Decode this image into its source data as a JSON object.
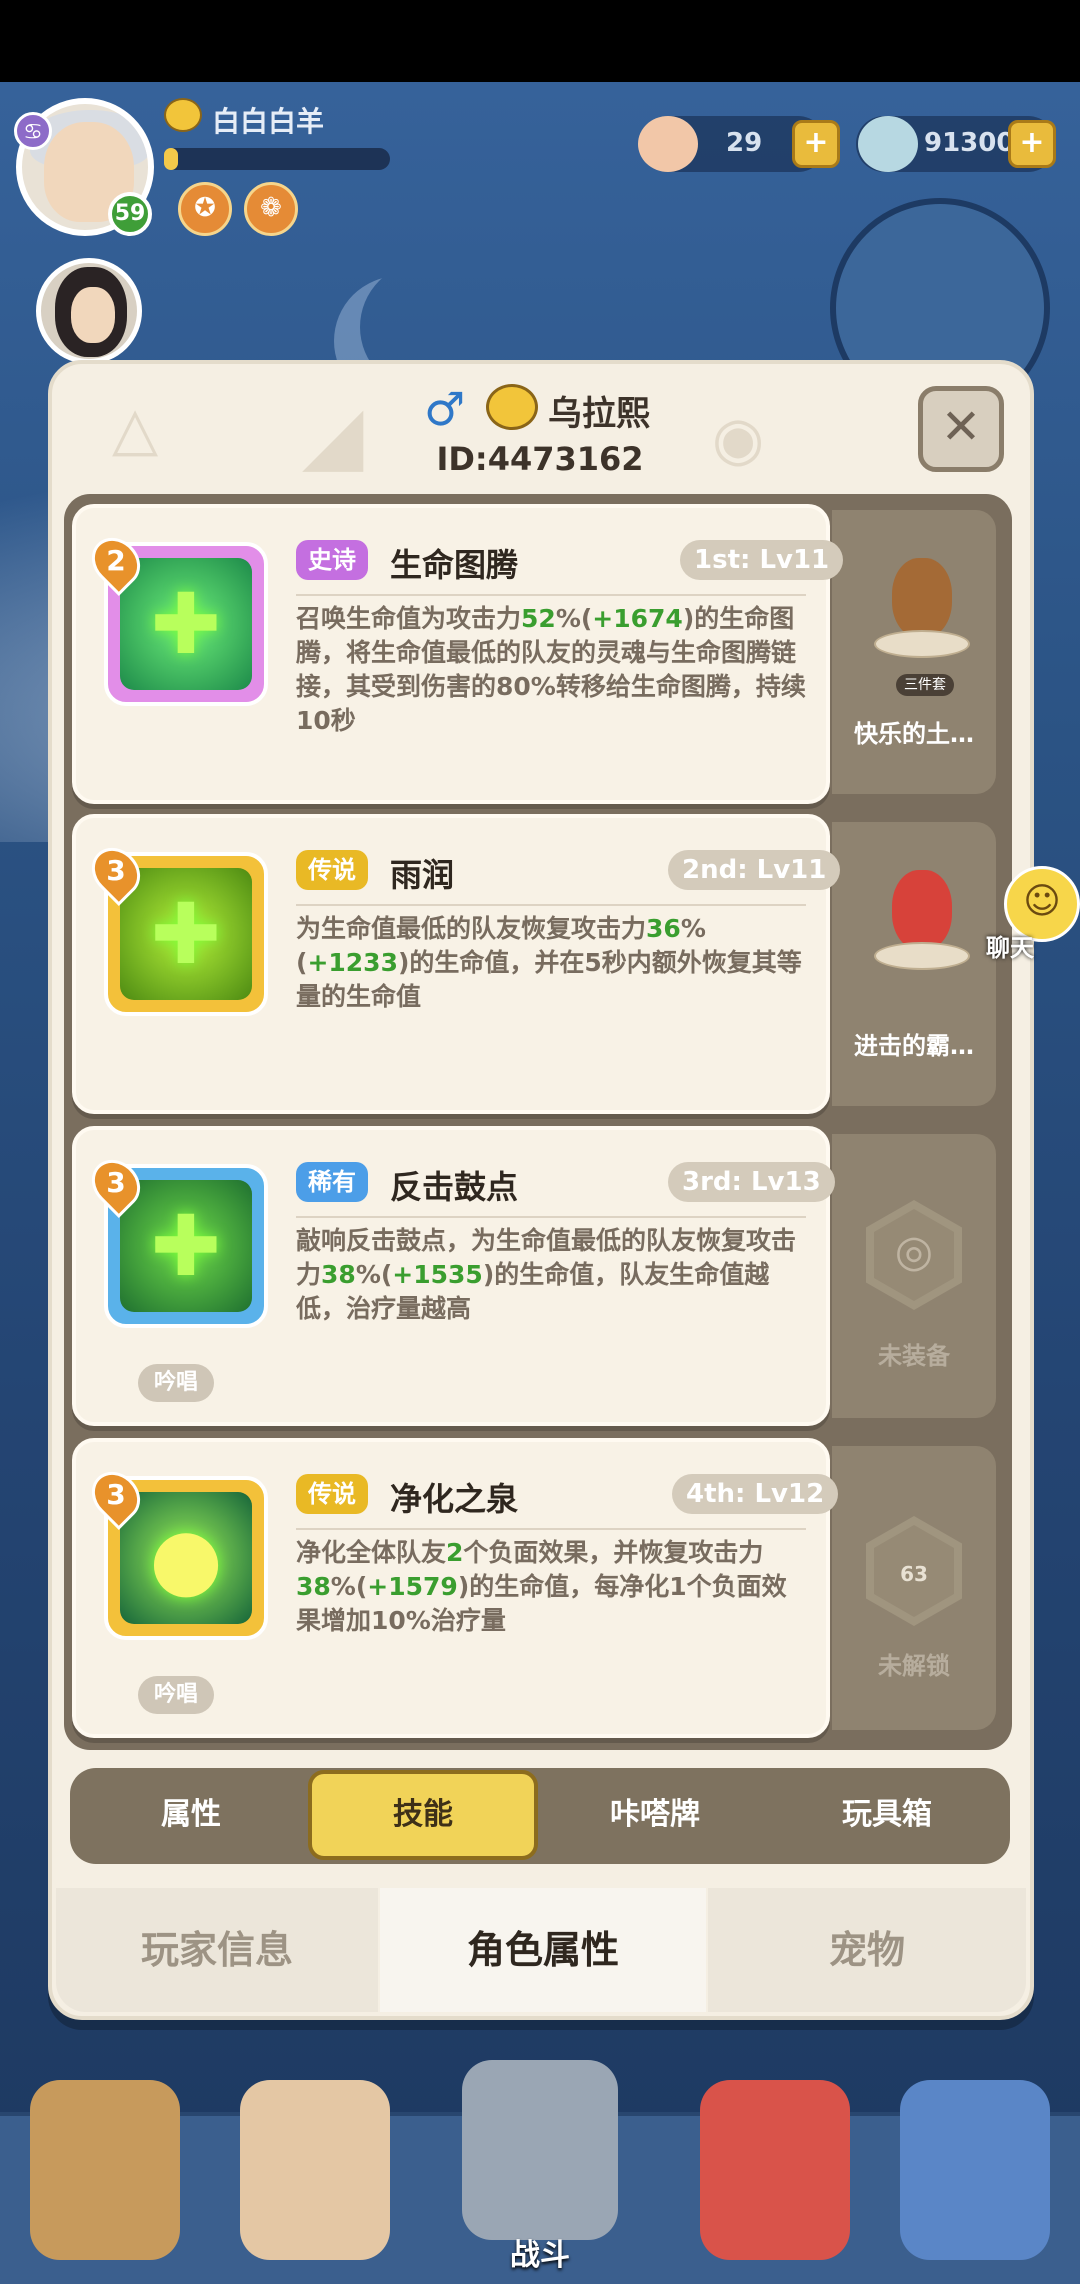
{
  "player": {
    "name": "白白白羊",
    "level": "59",
    "sign_glyph": "♋",
    "exp_fraction": 0.06
  },
  "resources": [
    {
      "icon": "shell-icon",
      "value": "29"
    },
    {
      "icon": "pearl-icon",
      "value": "91300"
    }
  ],
  "modal": {
    "gender_glyph": "♂",
    "name": "乌拉熙",
    "id": "ID:4473162",
    "close_glyph": "✕"
  },
  "skills": [
    {
      "level": "2",
      "rarity": "史诗",
      "rarity_color": "#c46fe0",
      "title": "生命图腾",
      "slot": "1st: Lv11",
      "desc_parts": [
        "召唤生命值为攻击力",
        "52",
        "%(",
        "+1674",
        ")的生命图腾，将生命值最低的队友的灵魂与生命图腾链接，其受到伤害的80%转移给生命图腾，持续10秒"
      ],
      "icon": "totem-icon"
    },
    {
      "level": "3",
      "rarity": "传说",
      "rarity_color": "#e9b925",
      "title": "雨润",
      "slot": "2nd: Lv11",
      "desc_parts": [
        "为生命值最低的队友恢复攻击力",
        "36",
        "%(",
        "+1233",
        ")的生命值，并在5秒内额外恢复其等量的生命值"
      ],
      "icon": "rain-heal-icon"
    },
    {
      "level": "3",
      "rarity": "稀有",
      "rarity_color": "#4c9ee8",
      "title": "反击鼓点",
      "slot": "3rd: Lv13",
      "desc_parts": [
        "敲响反击鼓点，为生命值最低的队友恢复攻击力",
        "38",
        "%(",
        "+1535",
        ")的生命值，队友生命值越低，治疗量越高"
      ],
      "tag": "吟唱",
      "icon": "drum-icon"
    },
    {
      "level": "3",
      "rarity": "传说",
      "rarity_color": "#e9b925",
      "title": "净化之泉",
      "slot": "4th: Lv12",
      "desc_parts": [
        "净化全体队友",
        "2",
        "个负面效果，并恢复攻击力",
        "38",
        "%(",
        "+1579",
        ")的生命值，每净化1个负面效果增加10%治疗量"
      ],
      "tag": "吟唱",
      "icon": "spring-icon"
    }
  ],
  "equipment": [
    {
      "label": "快乐的土…",
      "set_label": "三件套",
      "icon": "monkey-figure-icon"
    },
    {
      "label": "进击的霸…",
      "icon": "dino-figure-icon"
    },
    {
      "label": "未装备",
      "icon": "empty-hex-icon"
    },
    {
      "label": "未解锁",
      "lock_level": "63",
      "icon": "lock-icon"
    }
  ],
  "chat": {
    "label": "聊天"
  },
  "inner_tabs": [
    "属性",
    "技能",
    "咔嗒牌",
    "玩具箱"
  ],
  "section_tabs": [
    "玩家信息",
    "角色属性",
    "宠物"
  ],
  "bottom_nav": {
    "center_label": "战斗"
  },
  "colors": {
    "accent_yellow": "#f1d358",
    "highlight_green": "#3a9e2f",
    "modal_bg": "#f5efe3"
  }
}
